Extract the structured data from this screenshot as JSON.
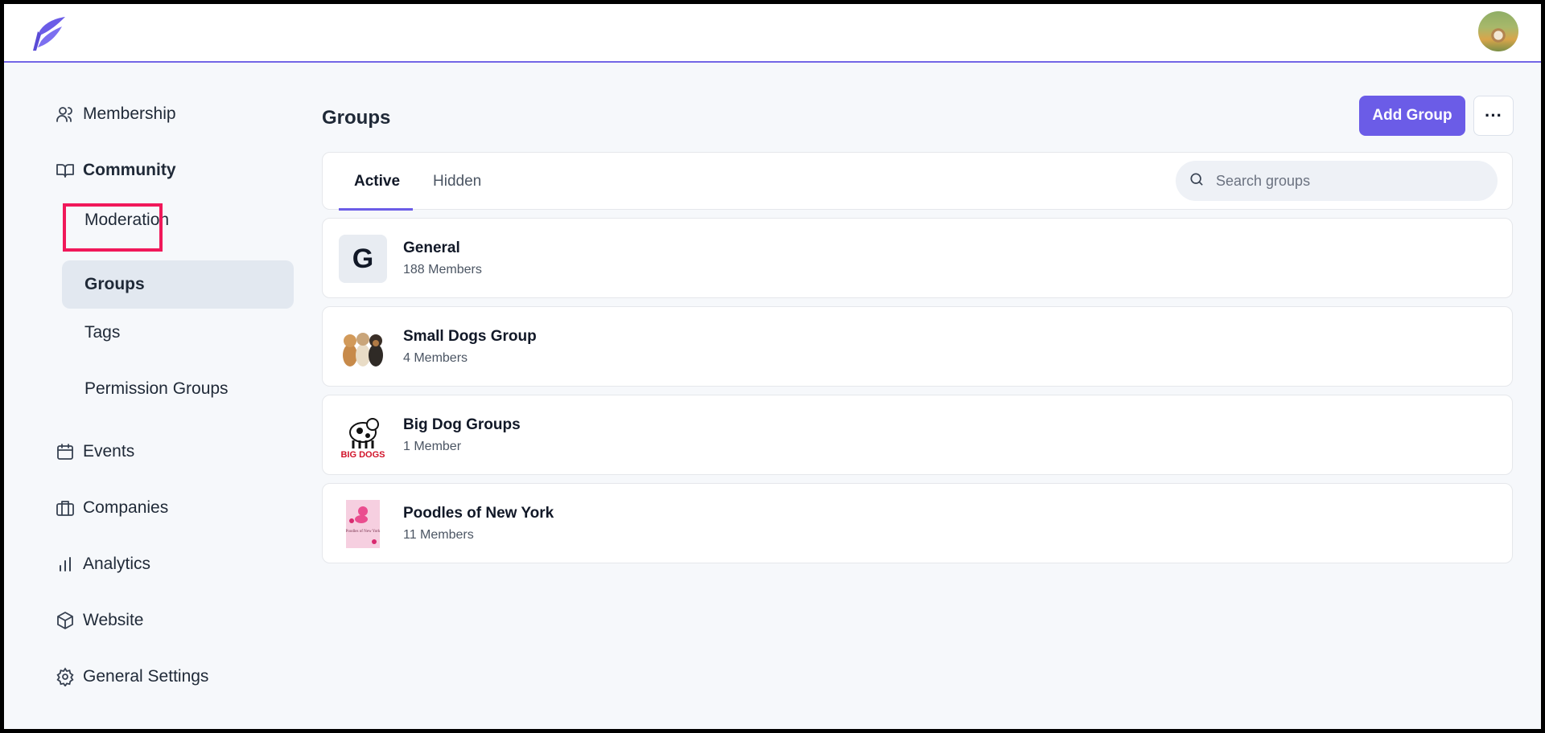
{
  "colors": {
    "accent": "#6b5ce7",
    "highlight": "#f0185a"
  },
  "sidebar": {
    "items": [
      {
        "label": "Membership",
        "icon": "users-icon"
      },
      {
        "label": "Community",
        "icon": "book-open-icon"
      },
      {
        "label": "Moderation"
      },
      {
        "label": "Groups"
      },
      {
        "label": "Tags"
      },
      {
        "label": "Permission Groups"
      },
      {
        "label": "Events",
        "icon": "calendar-icon"
      },
      {
        "label": "Companies",
        "icon": "briefcase-icon"
      },
      {
        "label": "Analytics",
        "icon": "bar-chart-icon"
      },
      {
        "label": "Website",
        "icon": "cube-icon"
      },
      {
        "label": "General Settings",
        "icon": "gear-icon"
      }
    ]
  },
  "main": {
    "title": "Groups",
    "add_label": "Add Group",
    "more_label": "···",
    "tabs": [
      {
        "label": "Active"
      },
      {
        "label": "Hidden"
      }
    ],
    "search": {
      "placeholder": "Search groups",
      "value": ""
    },
    "groups": [
      {
        "name": "General",
        "members": "188 Members",
        "letter": "G"
      },
      {
        "name": "Small Dogs Group",
        "members": "4 Members"
      },
      {
        "name": "Big Dog Groups",
        "members": "1 Member",
        "logo_text": "BIG DOGS"
      },
      {
        "name": "Poodles of New York",
        "members": "11 Members",
        "poster_text": "Poodles of New York"
      }
    ]
  }
}
